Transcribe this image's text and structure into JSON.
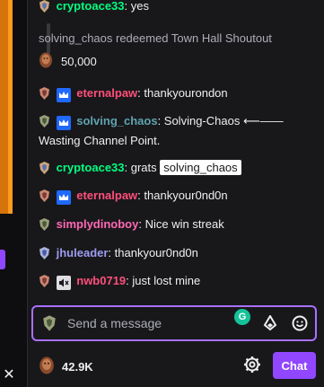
{
  "chat": {
    "messages": [
      {
        "user": "cryptoace33",
        "text": ": yes",
        "color": "#00ff7f",
        "badges": [
          "shield-badge"
        ]
      },
      {
        "user": "eternalpaw",
        "text": ": thankyourondon",
        "color": "#ff4f7a",
        "badges": [
          "shield-badge",
          "crown-badge"
        ]
      },
      {
        "user": "solving_chaos",
        "text": ": Solving-Chaos ⟵—— Wasting Channel Point.",
        "color": "#5fa3b0",
        "badges": [
          "shield-badge",
          "crown-badge"
        ]
      },
      {
        "user": "cryptoace33",
        "text": ": grats ",
        "mention": "solving_chaos",
        "color": "#00ff7f",
        "badges": [
          "shield-badge"
        ]
      },
      {
        "user": "eternalpaw",
        "text": ": thankyour0nd0n",
        "color": "#ff4f7a",
        "badges": [
          "shield-badge",
          "crown-badge"
        ]
      },
      {
        "user": "simplydinoboy",
        "text": ": Nice win streak",
        "color": "#ff69b4",
        "badges": [
          "shield-badge"
        ]
      },
      {
        "user": "jhuleader",
        "text": ": thankyour0nd0n",
        "color": "#9c9cf0",
        "badges": [
          "shield-badge"
        ]
      },
      {
        "user": "nwb0719",
        "text": ": just lost mine",
        "color": "#ff4f7a",
        "badges": [
          "shield-badge",
          "mute-badge"
        ]
      }
    ],
    "redemption": {
      "text": "solving_chaos redeemed Town Hall Shoutout",
      "cost": "50,000"
    }
  },
  "input": {
    "placeholder": "Send a message"
  },
  "footer": {
    "points": "42.9K",
    "chat_button": "Chat"
  },
  "icons": {
    "close": "✕"
  },
  "colors": {
    "accent": "#9147ff",
    "input_border": "#a970ff",
    "background": "#18181b"
  }
}
